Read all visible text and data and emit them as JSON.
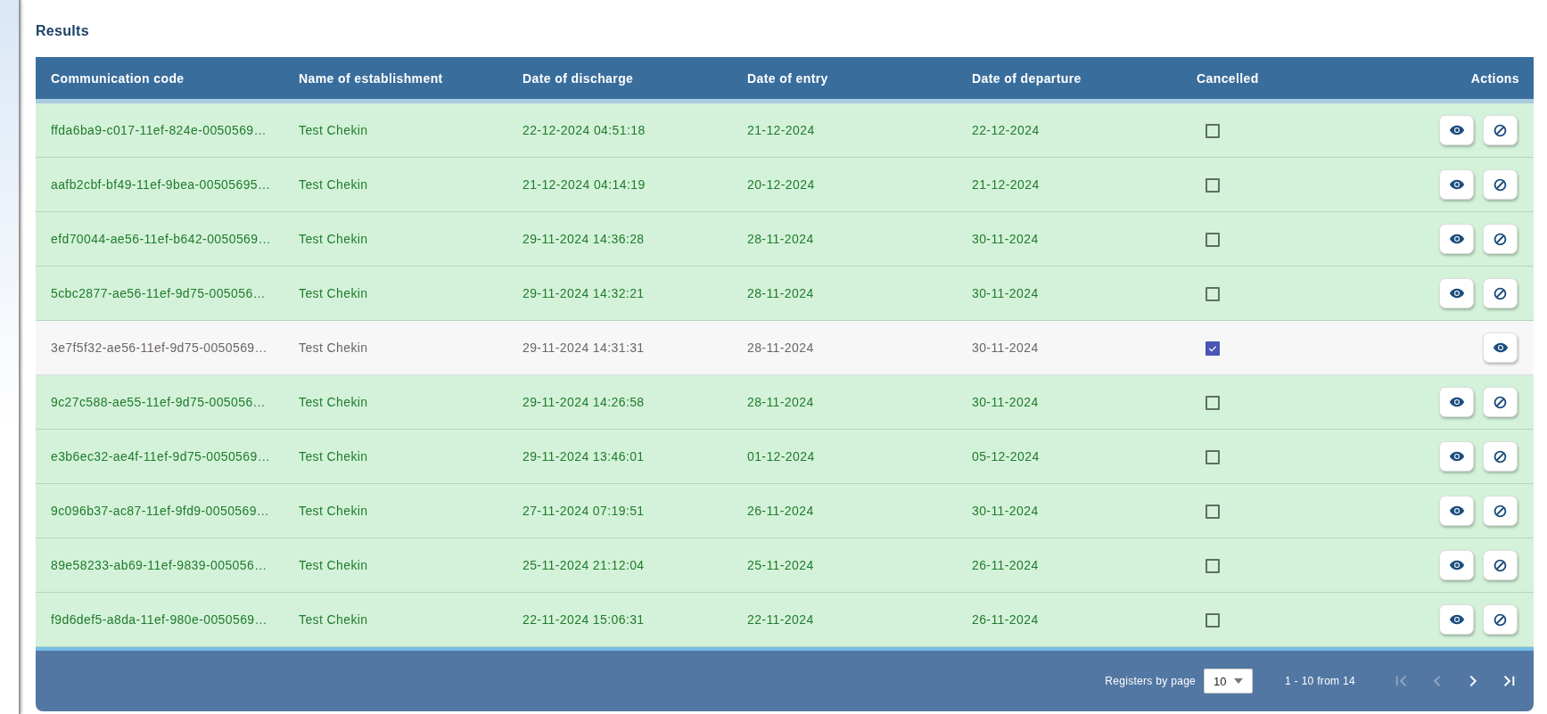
{
  "section_title": "Results",
  "table": {
    "columns": [
      "Communication code",
      "Name of establishment",
      "Date of discharge",
      "Date of entry",
      "Date of departure",
      "Cancelled",
      "Actions"
    ],
    "rows": [
      {
        "code": "ffda6ba9-c017-11ef-824e-0050569…",
        "name": "Test Chekin",
        "discharge": "22-12-2024 04:51:18",
        "entry": "21-12-2024",
        "departure": "22-12-2024",
        "cancelled": false
      },
      {
        "code": "aafb2cbf-bf49-11ef-9bea-00505695…",
        "name": "Test Chekin",
        "discharge": "21-12-2024 04:14:19",
        "entry": "20-12-2024",
        "departure": "21-12-2024",
        "cancelled": false
      },
      {
        "code": "efd70044-ae56-11ef-b642-0050569…",
        "name": "Test Chekin",
        "discharge": "29-11-2024 14:36:28",
        "entry": "28-11-2024",
        "departure": "30-11-2024",
        "cancelled": false
      },
      {
        "code": "5cbc2877-ae56-11ef-9d75-005056…",
        "name": "Test Chekin",
        "discharge": "29-11-2024 14:32:21",
        "entry": "28-11-2024",
        "departure": "30-11-2024",
        "cancelled": false
      },
      {
        "code": "3e7f5f32-ae56-11ef-9d75-0050569…",
        "name": "Test Chekin",
        "discharge": "29-11-2024 14:31:31",
        "entry": "28-11-2024",
        "departure": "30-11-2024",
        "cancelled": true
      },
      {
        "code": "9c27c588-ae55-11ef-9d75-005056…",
        "name": "Test Chekin",
        "discharge": "29-11-2024 14:26:58",
        "entry": "28-11-2024",
        "departure": "30-11-2024",
        "cancelled": false
      },
      {
        "code": "e3b6ec32-ae4f-11ef-9d75-0050569…",
        "name": "Test Chekin",
        "discharge": "29-11-2024 13:46:01",
        "entry": "01-12-2024",
        "departure": "05-12-2024",
        "cancelled": false
      },
      {
        "code": "9c096b37-ac87-11ef-9fd9-0050569…",
        "name": "Test Chekin",
        "discharge": "27-11-2024 07:19:51",
        "entry": "26-11-2024",
        "departure": "30-11-2024",
        "cancelled": false
      },
      {
        "code": "89e58233-ab69-11ef-9839-005056…",
        "name": "Test Chekin",
        "discharge": "25-11-2024 21:12:04",
        "entry": "25-11-2024",
        "departure": "26-11-2024",
        "cancelled": false
      },
      {
        "code": "f9d6def5-a8da-11ef-980e-0050569…",
        "name": "Test Chekin",
        "discharge": "22-11-2024 15:06:31",
        "entry": "22-11-2024",
        "departure": "26-11-2024",
        "cancelled": false
      }
    ]
  },
  "pagination": {
    "page_size_label": "Registers by page",
    "page_size": "10",
    "range": "1 - 10 from 14",
    "nav": [
      {
        "kind": "first",
        "disabled": true
      },
      {
        "kind": "prev",
        "disabled": true
      },
      {
        "kind": "next",
        "disabled": false
      },
      {
        "kind": "last",
        "disabled": false
      }
    ]
  }
}
